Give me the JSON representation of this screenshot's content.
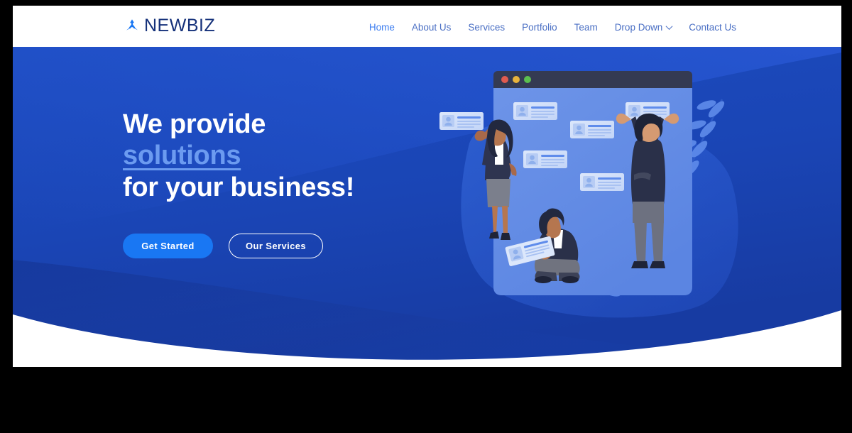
{
  "brand": {
    "name": "NEWBIZ",
    "icon": "arrows-diverge-icon",
    "color": "#15317a",
    "icon_color": "#1977f3"
  },
  "nav": {
    "items": [
      {
        "label": "Home",
        "name": "nav-item-home",
        "active": true
      },
      {
        "label": "About Us",
        "name": "nav-item-about-us",
        "active": false
      },
      {
        "label": "Services",
        "name": "nav-item-services",
        "active": false
      },
      {
        "label": "Portfolio",
        "name": "nav-item-portfolio",
        "active": false
      },
      {
        "label": "Team",
        "name": "nav-item-team",
        "active": false
      },
      {
        "label": "Drop Down",
        "name": "nav-item-drop-down",
        "active": false,
        "has_chevron": true
      },
      {
        "label": "Contact Us",
        "name": "nav-item-contact-us",
        "active": false
      }
    ],
    "active_color": "#3d7ef0",
    "idle_color": "#4a6fc4"
  },
  "hero": {
    "headline": {
      "line1": "We provide",
      "line2": "solutions",
      "line3": "for your business!"
    },
    "accent_color": "#6c9bf0",
    "background_color": "#1a45b5",
    "background_dark": "#17399c",
    "buttons": {
      "primary": {
        "label": "Get Started",
        "color": "#1977f3"
      },
      "secondary": {
        "label": "Our Services",
        "color": "#ffffff"
      }
    },
    "illustration": {
      "name": "team-pinning-profile-cards-illustration",
      "window_dots": [
        "#e05b4f",
        "#e8b33c",
        "#5bbf4f"
      ],
      "card_count": 7,
      "people": [
        "woman-standing",
        "person-sitting",
        "man-reaching"
      ],
      "decor": "laurel-branch"
    }
  }
}
